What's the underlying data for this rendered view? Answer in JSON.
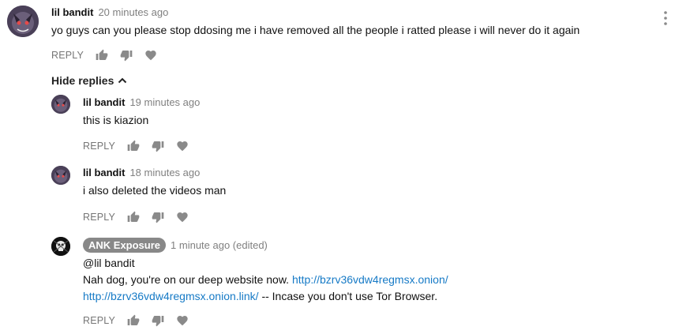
{
  "comments": {
    "main": {
      "author": "lil bandit",
      "time": "20 minutes ago",
      "text": "yo guys can you please stop ddosing me i have removed all the people i ratted please i will never do it again",
      "reply_label": "REPLY"
    },
    "toggle_label": "Hide replies",
    "replies": [
      {
        "author": "lil bandit",
        "time": "19 minutes ago",
        "text": "this is kiazion",
        "reply_label": "REPLY"
      },
      {
        "author": "lil bandit",
        "time": "18 minutes ago",
        "text": "i also deleted the videos man",
        "reply_label": "REPLY"
      },
      {
        "author": "ANK Exposure",
        "time": "1 minute ago (edited)",
        "line1": "@lil bandit",
        "line2_text": "Nah dog, you're on our deep website now.",
        "link1": "http://bzrv36vdw4regmsx.onion/",
        "link2": "http://bzrv36vdw4regmsx.onion.link/",
        "line3_suffix": "-- Incase you don't use Tor Browser.",
        "reply_label": "REPLY"
      }
    ]
  },
  "icons": [
    "thumbs-up-icon",
    "thumbs-down-icon",
    "heart-icon",
    "chevron-up-icon",
    "more-vert-icon"
  ],
  "colors": {
    "link": "#167ac6",
    "muted": "#808080",
    "badge": "#888888"
  }
}
